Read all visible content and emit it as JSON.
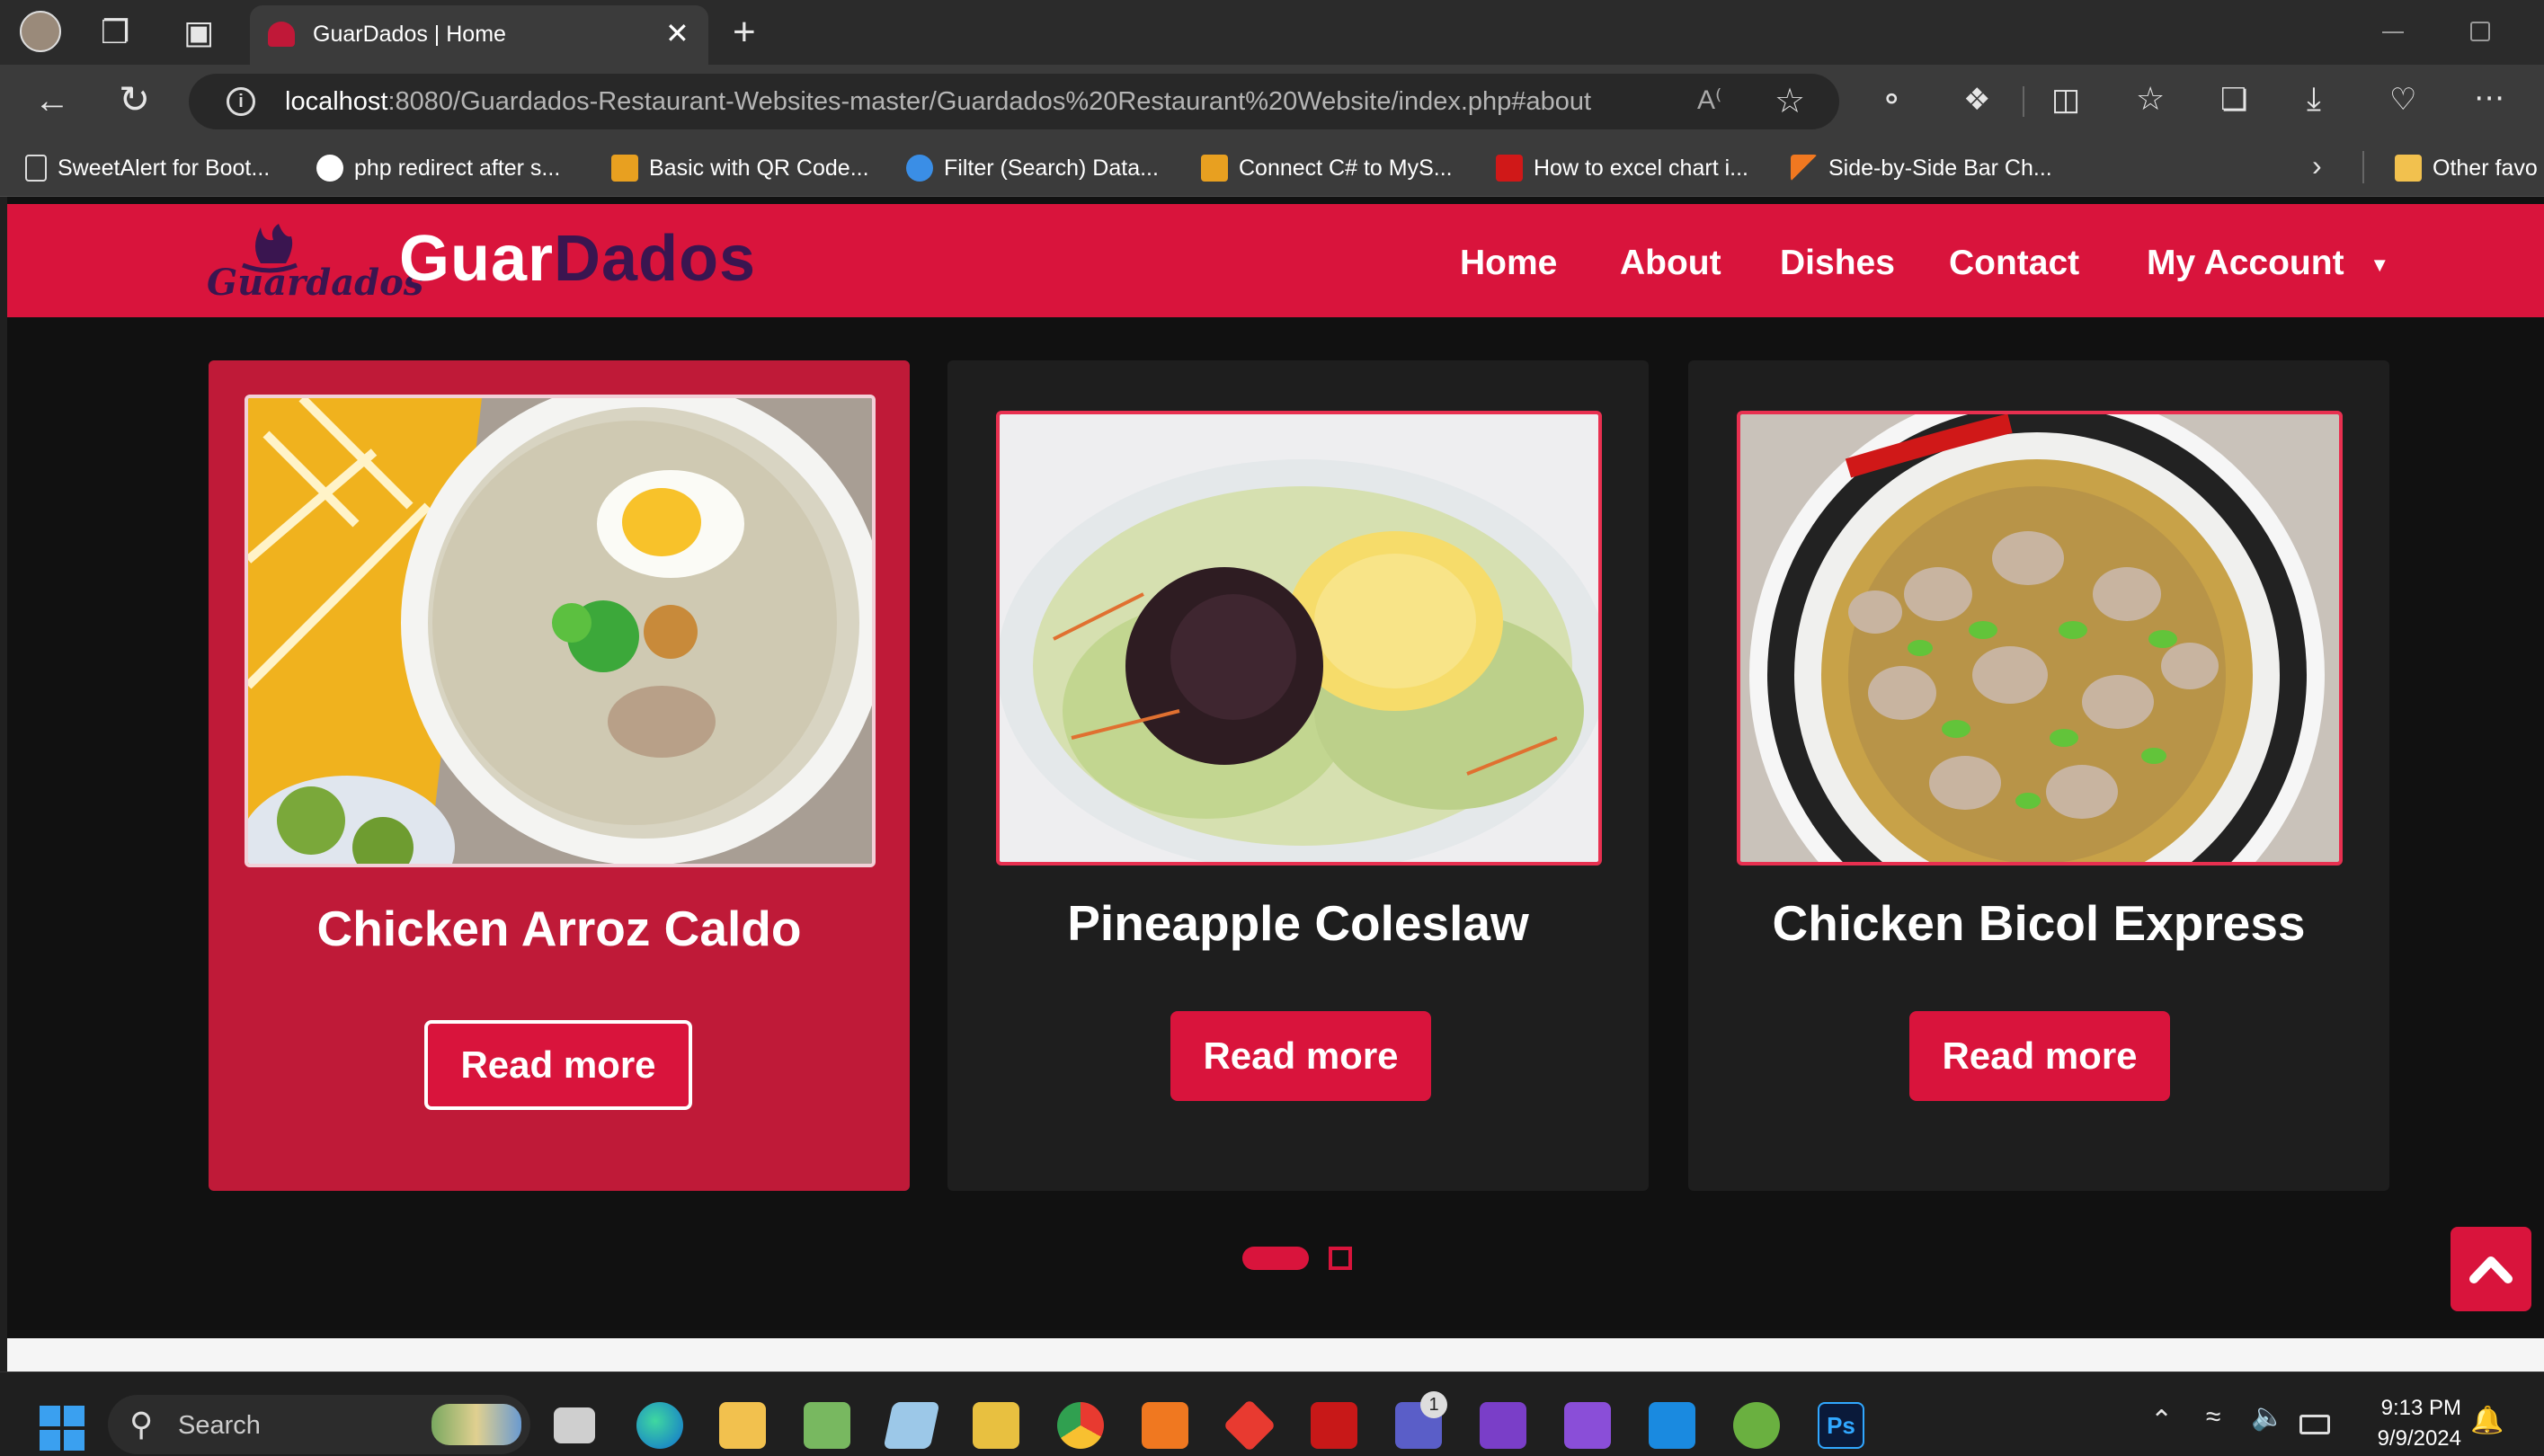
{
  "browser": {
    "tab_title": "GuarDados | Home",
    "url_host": "localhost",
    "url_rest": ":8080/Guardados-Restaurant-Websites-master/Guardados%20Restaurant%20Website/index.php#about",
    "bookmarks": [
      "SweetAlert for Boot...",
      "php redirect after s...",
      "Basic with QR Code...",
      "Filter (Search) Data...",
      "Connect C# to MyS...",
      "How to excel chart i...",
      "Side-by-Side Bar Ch..."
    ],
    "other_favorites": "Other favo"
  },
  "site": {
    "logo_script": "Guardados",
    "brand_light": "Guar",
    "brand_dark": "Dados",
    "nav": [
      "Home",
      "About",
      "Dishes",
      "Contact",
      "My Account"
    ]
  },
  "dishes": [
    {
      "title": "Chicken Arroz Caldo",
      "button": "Read more"
    },
    {
      "title": "Pineapple Coleslaw",
      "button": "Read more"
    },
    {
      "title": "Chicken Bicol Express",
      "button": "Read more"
    }
  ],
  "taskbar": {
    "search_label": "Search",
    "time": "9:13 PM",
    "date": "9/9/2024",
    "teams_badge": "1"
  },
  "colors": {
    "brand_red": "#d9143c",
    "card_active": "#bf1a38",
    "card_dark": "#1e1e1e",
    "brand_purple": "#3a1550"
  },
  "icons": [
    "profile-avatar-icon",
    "workspaces-icon",
    "tab-actions-icon",
    "close-icon",
    "new-tab-icon",
    "back-icon",
    "refresh-icon",
    "info-icon",
    "read-aloud-icon",
    "favorite-star-icon",
    "extensions-icon",
    "split-screen-icon",
    "favorites-icon",
    "collections-icon",
    "download-icon",
    "browser-essentials-icon",
    "more-icon",
    "chevron-up-icon",
    "windows-start-icon",
    "search-icon",
    "wifi-icon",
    "volume-icon",
    "battery-icon",
    "bell-icon"
  ]
}
